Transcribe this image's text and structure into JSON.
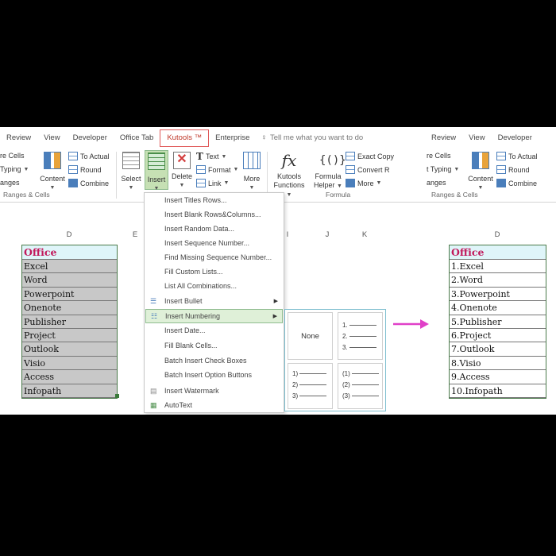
{
  "left_panel": {
    "tabs": [
      "Review",
      "View",
      "Developer",
      "Office Tab",
      "Kutools ™",
      "Enterprise"
    ],
    "tell_me": "Tell me what you want to do",
    "ribbon": {
      "partial_rows": [
        "re Cells",
        "Typing",
        "anges"
      ],
      "to_actual": "To Actual",
      "round": "Round",
      "combine": "Combine",
      "content": "Content",
      "group_ranges": "Ranges & Cells",
      "select": "Select",
      "insert": "Insert",
      "delete": "Delete",
      "text": "Text",
      "format": "Format",
      "link": "Link",
      "more": "More",
      "kutools_functions_1": "Kutools",
      "kutools_functions_2": "Functions",
      "formula_helper_1": "Formula",
      "formula_helper_2": "Helper",
      "exact_copy": "Exact Copy",
      "convert_refs": "Convert R",
      "more2": "More",
      "group_formula": "Formula"
    },
    "columns": [
      "D",
      "E",
      "I",
      "J",
      "K"
    ],
    "office_header": "Office",
    "items": [
      "Excel",
      "Word",
      "Powerpoint",
      "Onenote",
      "Publisher",
      "Project",
      "Outlook",
      "Visio",
      "Access",
      "Infopath"
    ]
  },
  "menu": {
    "items": [
      {
        "label": "Insert Titles Rows...",
        "icon": "",
        "submenu": false
      },
      {
        "label": "Insert Blank Rows&Columns...",
        "icon": "",
        "submenu": false
      },
      {
        "label": "Insert Random Data...",
        "icon": "",
        "submenu": false
      },
      {
        "label": "Insert Sequence Number...",
        "icon": "",
        "submenu": false
      },
      {
        "label": "Find Missing Sequence Number...",
        "icon": "",
        "submenu": false
      },
      {
        "label": "Fill Custom Lists...",
        "icon": "",
        "submenu": false
      },
      {
        "label": "List All Combinations...",
        "icon": "",
        "submenu": false
      },
      {
        "label": "Insert Bullet",
        "icon": "bullet-list-icon",
        "submenu": true
      },
      {
        "label": "Insert Numbering",
        "icon": "numbered-list-icon",
        "submenu": true,
        "active": true
      },
      {
        "label": "Insert Date...",
        "icon": "",
        "submenu": false
      },
      {
        "label": "Fill Blank Cells...",
        "icon": "",
        "submenu": false
      },
      {
        "label": "Batch Insert Check Boxes",
        "icon": "",
        "submenu": false
      },
      {
        "label": "Batch Insert Option Buttons",
        "icon": "",
        "submenu": false
      },
      {
        "label": "Insert Watermark",
        "icon": "watermark-icon",
        "submenu": false
      },
      {
        "label": "AutoText",
        "icon": "autotext-icon",
        "submenu": false
      }
    ]
  },
  "numbering_submenu": {
    "none_label": "None",
    "style_dot": [
      "1.",
      "2.",
      "3."
    ],
    "style_paren": [
      "1)",
      "2)",
      "3)"
    ],
    "style_circle": [
      "(1)",
      "(2)",
      "(3)"
    ]
  },
  "right_panel": {
    "tabs": [
      "Review",
      "View",
      "Developer"
    ],
    "ribbon": {
      "partial_rows": [
        "re Cells",
        "t Typing",
        "anges"
      ],
      "to_actual": "To Actual",
      "round": "Round",
      "combine": "Combine",
      "content": "Content",
      "group_ranges": "Ranges & Cells"
    },
    "column": "D",
    "office_header": "Office",
    "items": [
      "1.Excel",
      "2.Word",
      "3.Powerpoint",
      "4.Onenote",
      "5.Publisher",
      "6.Project",
      "7.Outlook",
      "8.Visio",
      "9.Access",
      "10.Infopath"
    ]
  },
  "colors": {
    "kutools_tab": "#c0392b",
    "office_header_text": "#c2185b",
    "office_header_bg": "#dff5f9",
    "arrow": "#e040c8",
    "selection": "#3a7a3a"
  }
}
